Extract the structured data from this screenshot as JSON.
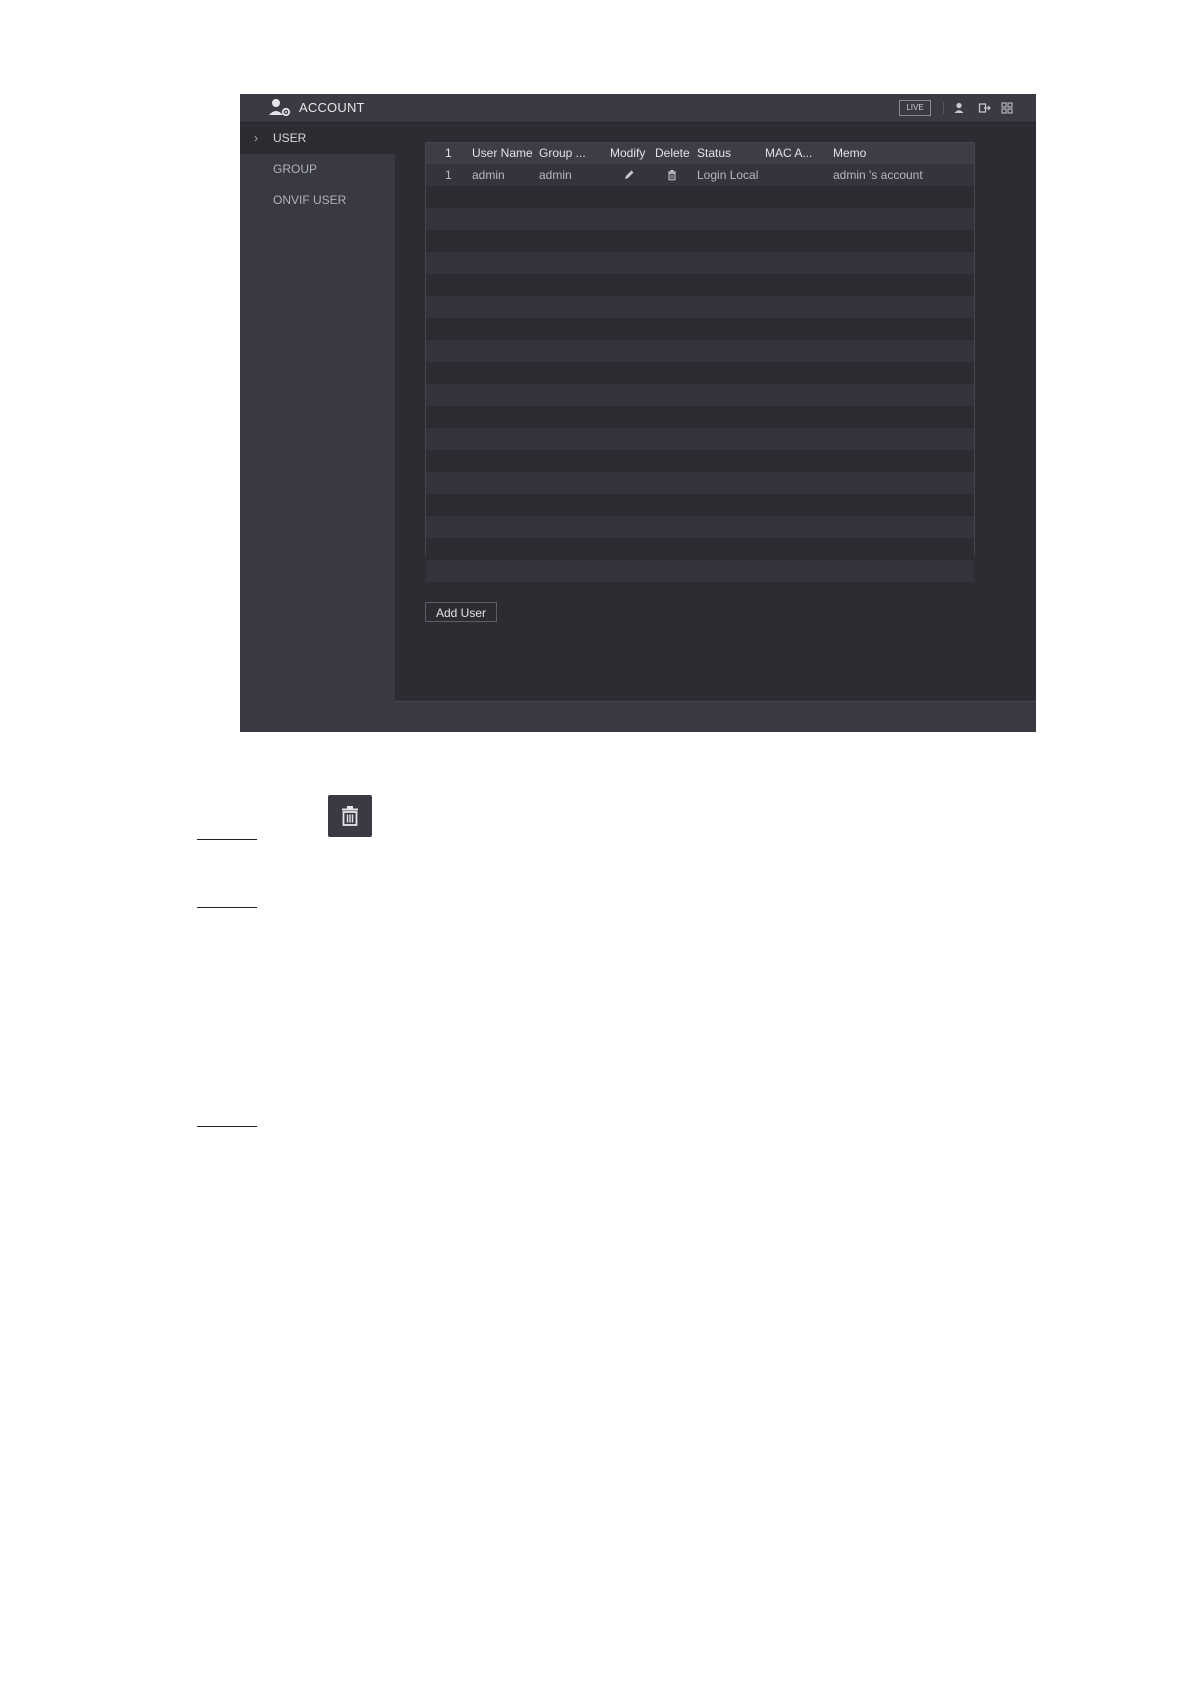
{
  "window": {
    "title": "ACCOUNT",
    "live_label": "LIVE"
  },
  "sidebar": {
    "items": [
      {
        "label": "USER",
        "active": true
      },
      {
        "label": "GROUP",
        "active": false
      },
      {
        "label": "ONVIF USER",
        "active": false
      }
    ]
  },
  "table": {
    "headers": [
      "1",
      "User Name",
      "Group ...",
      "Modify",
      "Delete",
      "Status",
      "MAC A...",
      "Memo"
    ],
    "rows": [
      {
        "index": "1",
        "user_name": "admin",
        "group": "admin",
        "modify_icon": "pencil-icon",
        "delete_icon": "trash-icon",
        "status": "Login Local",
        "mac": "",
        "memo": "admin 's account"
      }
    ],
    "empty_rows": 18
  },
  "buttons": {
    "add_user": "Add User"
  },
  "icons": {
    "title": "account-settings-icon",
    "toolbar": [
      "user-icon",
      "logout-icon",
      "grid-icon"
    ],
    "doc_sample": "trash-icon"
  },
  "colors": {
    "window_bg": "#2c2d33",
    "titlebar_bg": "#3a3b42",
    "sidebar_bg": "#393a41"
  }
}
